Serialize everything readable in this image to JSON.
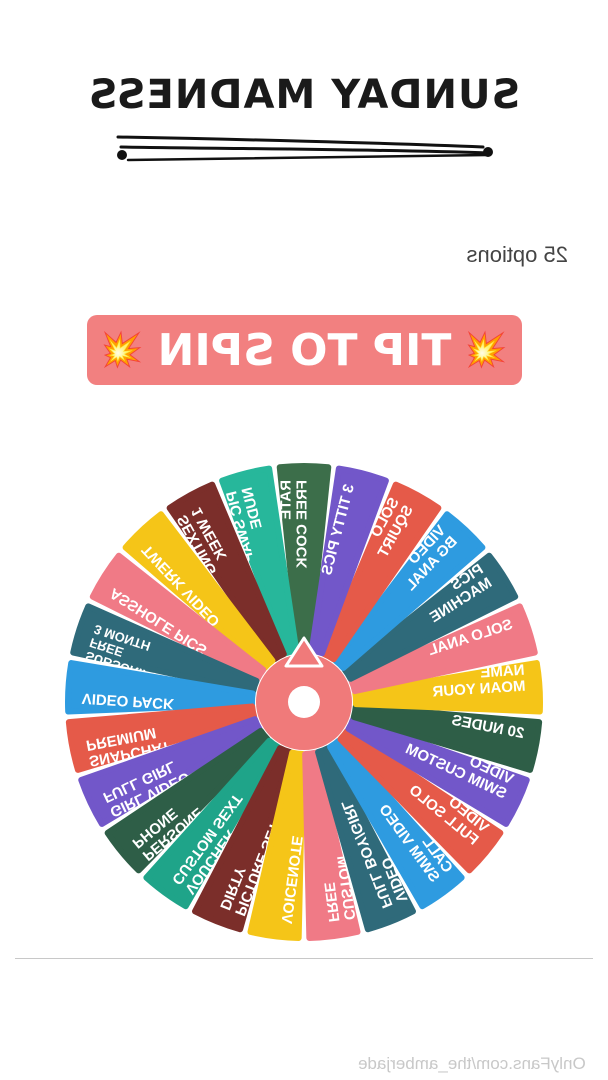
{
  "header": {
    "title": "SUNDAY MADNESS"
  },
  "options_count": "25 options",
  "spin_button": {
    "label": "TIP TO SPIN",
    "left_icon": "collision-icon",
    "right_icon": "collision-icon"
  },
  "wheel": {
    "colors": [
      "#3c6e4a",
      "#27b79b",
      "#7b2e2a",
      "#f5c518",
      "#f07a86",
      "#2f6a7a",
      "#2e9be0",
      "#e55a49",
      "#7257c9",
      "#2e5e47",
      "#1fa489",
      "#7b2e2a",
      "#f5c518",
      "#f07a86",
      "#2f6a7a",
      "#2e9be0",
      "#e55a49",
      "#7257c9",
      "#2e5e47",
      "#f5c518",
      "#f07a86",
      "#2f6a7a",
      "#2e9be0",
      "#e55a49",
      "#7257c9"
    ],
    "segments": [
      [
        "FREE COCK",
        "RATE"
      ],
      [
        "NUDE",
        "PIC SWAP"
      ],
      [
        "1 WEEK",
        "SEXTING"
      ],
      [
        "TWERK VIDEO"
      ],
      [
        "ASSHOLE PICS"
      ],
      [
        "3 MONTH",
        "FREE",
        "SUBSCRIPTION"
      ],
      [
        "VIDEO PACK"
      ],
      [
        "PREMIUM",
        "SNAPCHAT"
      ],
      [
        "FULL GIRL",
        "GIRL VIDEO"
      ],
      [
        "PHONE",
        "PERSONE"
      ],
      [
        "CUSTOM SEXT",
        "VOUCHER"
      ],
      [
        "DIRTY",
        "PICTURE SET"
      ],
      [
        "VOICENOTE"
      ],
      [
        "FREE",
        "CUSTOM"
      ],
      [
        "FULL BOY/GIRL",
        "VIDEO"
      ],
      [
        "SWIM VIDEO",
        "CALL"
      ],
      [
        "FULL SOLO",
        "VIDEO"
      ],
      [
        "SWIM CUSTOM",
        "VIDEO"
      ],
      [
        "20 NUDES"
      ],
      [
        "MOAN YOUR",
        "NAME"
      ],
      [
        "SOLO ANAL"
      ],
      [
        "MACHINE",
        "PICS"
      ],
      [
        "BG ANAL",
        "VIDEO"
      ],
      [
        "SQUIRT",
        "SOLO"
      ],
      [
        "3 TITTY PICS"
      ]
    ]
  },
  "footer": {
    "watermark": "OnlyFans.com/the_amberjade"
  }
}
